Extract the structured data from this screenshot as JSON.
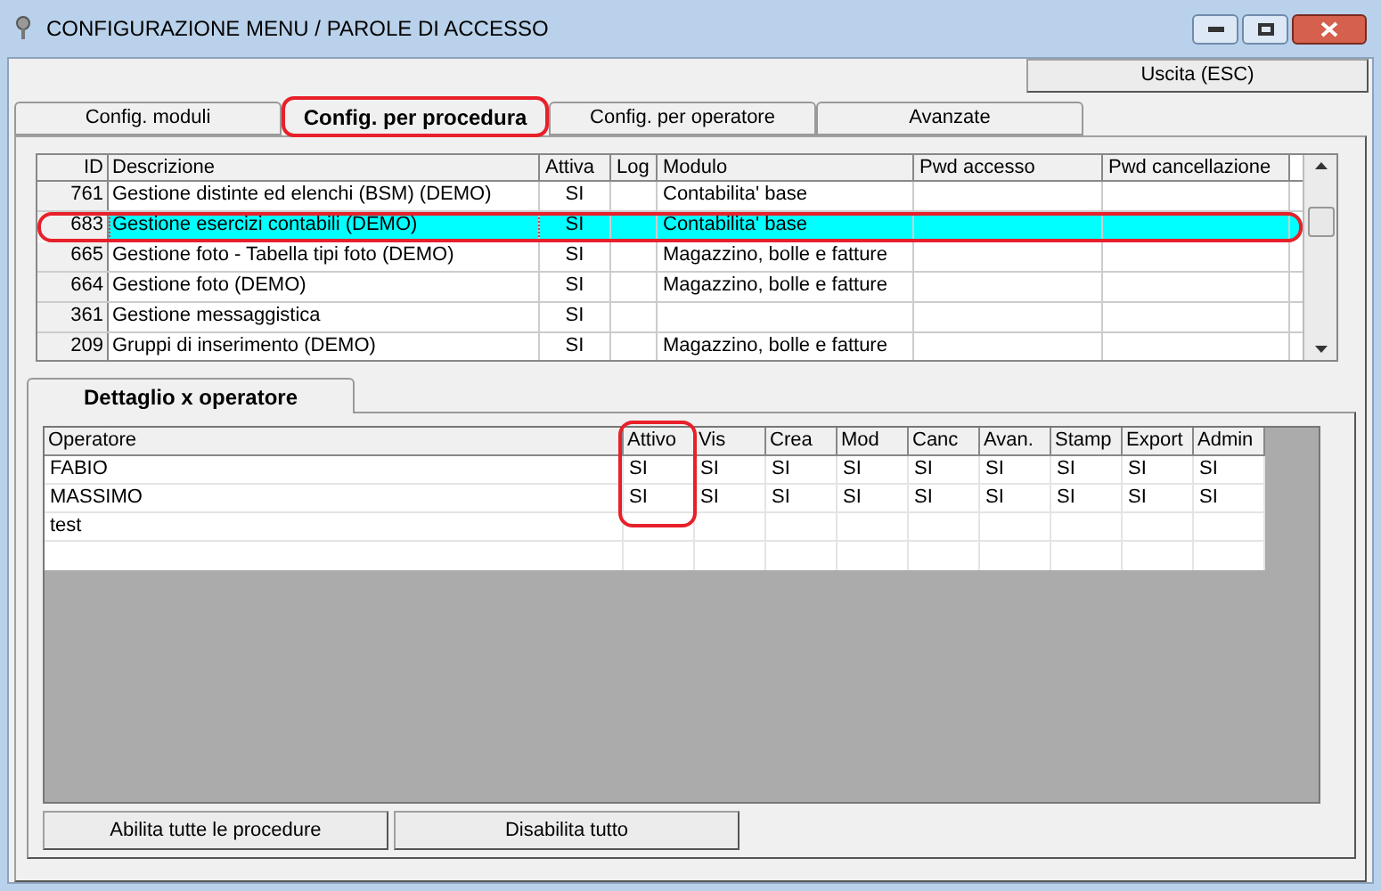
{
  "window": {
    "title": "CONFIGURAZIONE MENU / PAROLE DI ACCESSO"
  },
  "exit_button": {
    "label": "Uscita (ESC)"
  },
  "tabs": [
    {
      "label": "Config. moduli",
      "selected": false,
      "circled": false
    },
    {
      "label": "Config. per procedura",
      "selected": true,
      "circled": true
    },
    {
      "label": "Config. per operatore",
      "selected": false,
      "circled": false
    },
    {
      "label": "Avanzate",
      "selected": false,
      "circled": false
    }
  ],
  "procedures": {
    "columns": [
      {
        "label": "ID"
      },
      {
        "label": "Descrizione"
      },
      {
        "label": "Attiva"
      },
      {
        "label": "Log"
      },
      {
        "label": "Modulo"
      },
      {
        "label": "Pwd accesso"
      },
      {
        "label": "Pwd cancellazione"
      }
    ],
    "rows": [
      {
        "cells": [
          "761",
          "Gestione distinte ed elenchi (BSM) (DEMO)",
          "SI",
          "",
          "Contabilita' base",
          "",
          ""
        ],
        "selected": false,
        "circled": false
      },
      {
        "cells": [
          "683",
          "Gestione esercizi contabili (DEMO)",
          "SI",
          "",
          "Contabilita' base",
          "",
          ""
        ],
        "selected": true,
        "circled": true
      },
      {
        "cells": [
          "665",
          "Gestione foto - Tabella tipi foto (DEMO)",
          "SI",
          "",
          "Magazzino, bolle e fatture",
          "",
          ""
        ],
        "selected": false,
        "circled": false
      },
      {
        "cells": [
          "664",
          "Gestione foto (DEMO)",
          "SI",
          "",
          "Magazzino, bolle e fatture",
          "",
          ""
        ],
        "selected": false,
        "circled": false
      },
      {
        "cells": [
          "361",
          "Gestione messaggistica",
          "SI",
          "",
          "",
          "",
          ""
        ],
        "selected": false,
        "circled": false
      },
      {
        "cells": [
          "209",
          "Gruppi di inserimento (DEMO)",
          "SI",
          "",
          "Magazzino, bolle e fatture",
          "",
          ""
        ],
        "selected": false,
        "circled": false
      }
    ]
  },
  "detail_tab": {
    "label": "Dettaglio x operatore",
    "selected": true
  },
  "operators": {
    "columns": [
      {
        "label": "Operatore",
        "circled": false
      },
      {
        "label": "Attivo",
        "circled": true
      },
      {
        "label": "Vis",
        "circled": false
      },
      {
        "label": "Crea",
        "circled": false
      },
      {
        "label": "Mod",
        "circled": false
      },
      {
        "label": "Canc",
        "circled": false
      },
      {
        "label": "Avan.",
        "circled": false
      },
      {
        "label": "Stamp",
        "circled": false
      },
      {
        "label": "Export",
        "circled": false
      },
      {
        "label": "Admin",
        "circled": false
      }
    ],
    "rows": [
      {
        "cells": [
          "FABIO",
          "SI",
          "SI",
          "SI",
          "SI",
          "SI",
          "SI",
          "SI",
          "SI",
          "SI"
        ]
      },
      {
        "cells": [
          "MASSIMO",
          "SI",
          "SI",
          "SI",
          "SI",
          "SI",
          "SI",
          "SI",
          "SI",
          "SI"
        ]
      },
      {
        "cells": [
          "test",
          "",
          "",
          "",
          "",
          "",
          "",
          "",
          "",
          ""
        ]
      }
    ]
  },
  "buttons": [
    {
      "label": "Abilita tutte le procedure"
    },
    {
      "label": "Disabilita tutto"
    }
  ]
}
